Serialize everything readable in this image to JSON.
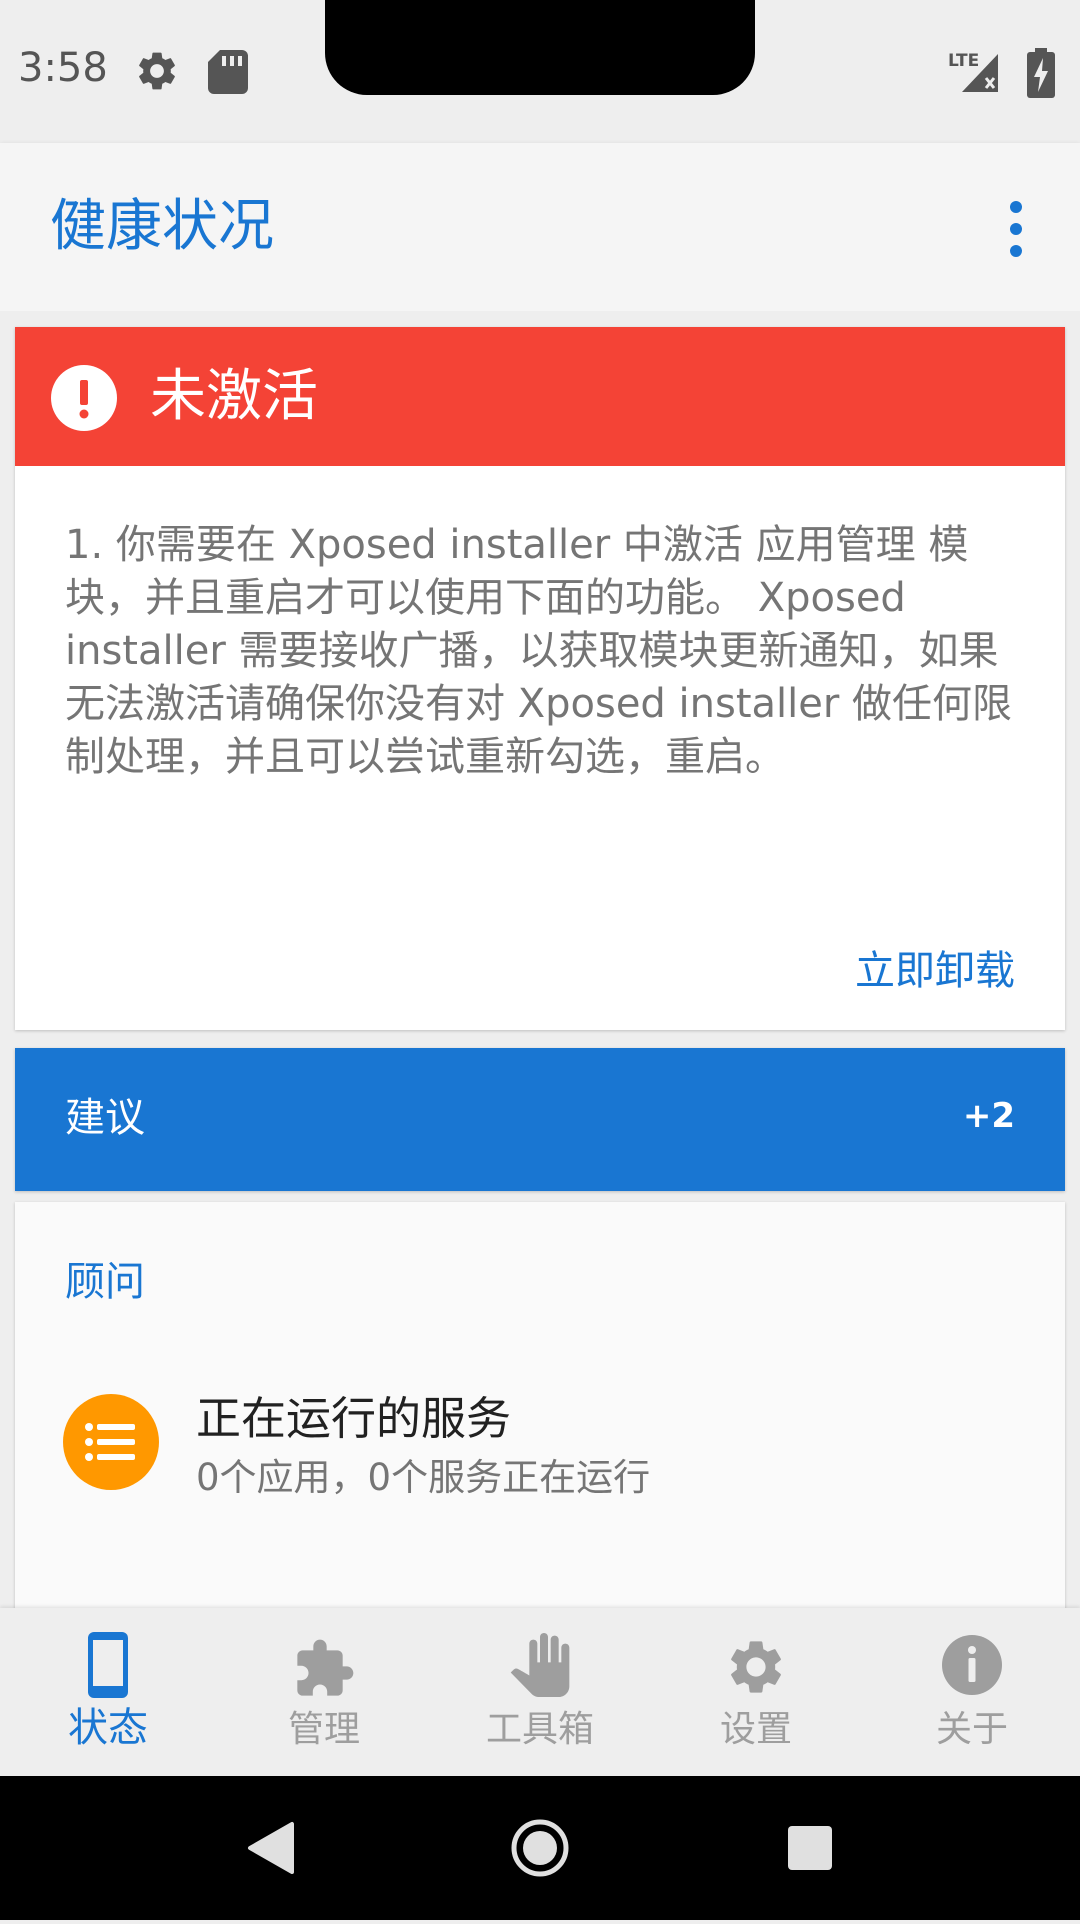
{
  "status_bar": {
    "time": "3:58",
    "icons": [
      "gear-icon",
      "sd-card-icon",
      "lte-signal-icon",
      "battery-charging-icon"
    ],
    "network_label": "LTE"
  },
  "app_bar": {
    "title": "健康状况",
    "menu_icon": "more-vert-icon"
  },
  "status_card": {
    "title": "未激活",
    "icon": "alert-circle-icon",
    "color": "#f44336",
    "body": "1. 你需要在 Xposed installer 中激活 应用管理 模块，并且重启才可以使用下面的功能。 Xposed installer 需要接收广播，以获取模块更新通知，如果无法激活请确保你没有对 Xposed installer 做任何限制处理，并且可以尝试重新勾选，重启。",
    "action_label": "立即卸载"
  },
  "suggestions": {
    "title": "建议",
    "count": "+2",
    "color": "#1976d2"
  },
  "advisor": {
    "title": "顾问",
    "items": [
      {
        "icon": "list-icon",
        "title": "正在运行的服务",
        "subtitle": "0个应用，0个服务正在运行",
        "icon_color": "#ff9800"
      }
    ]
  },
  "bottom_nav": {
    "active_index": 0,
    "items": [
      {
        "label": "状态",
        "icon": "phone-icon"
      },
      {
        "label": "管理",
        "icon": "puzzle-icon"
      },
      {
        "label": "工具箱",
        "icon": "hand-icon"
      },
      {
        "label": "设置",
        "icon": "gear-icon"
      },
      {
        "label": "关于",
        "icon": "info-icon"
      }
    ]
  },
  "system_nav": {
    "buttons": [
      "back-icon",
      "home-icon",
      "recents-icon"
    ]
  },
  "colors": {
    "accent": "#1976d2",
    "error": "#f44336",
    "warning": "#ff9800"
  }
}
